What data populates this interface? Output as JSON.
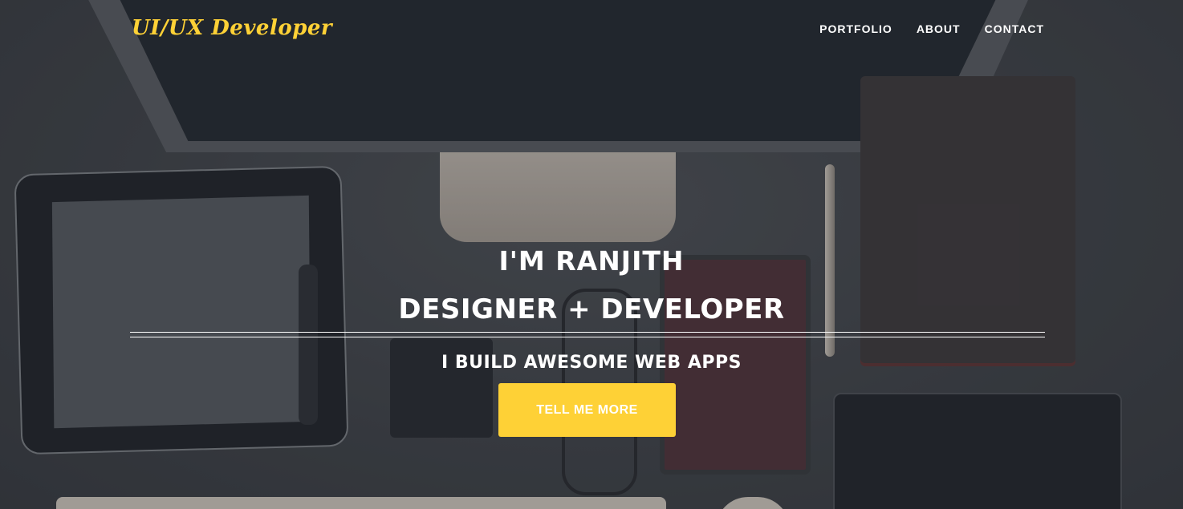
{
  "brand": {
    "label": "UI/UX Developer",
    "color": "#fed136"
  },
  "nav": {
    "items": [
      {
        "label": "PORTFOLIO"
      },
      {
        "label": "ABOUT"
      },
      {
        "label": "CONTACT"
      }
    ]
  },
  "hero": {
    "line1": "I'M RANJITH",
    "line2": "DESIGNER + DEVELOPER",
    "line3": "I BUILD AWESOME WEB APPS",
    "cta_label": "TELL ME MORE",
    "cta_color": "#fed136"
  }
}
